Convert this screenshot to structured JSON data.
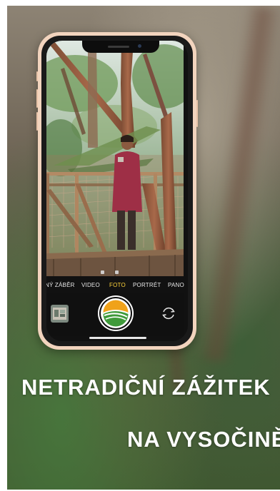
{
  "camera": {
    "modes": [
      {
        "label": "NÝ ZÁBĚR",
        "active": false
      },
      {
        "label": "VIDEO",
        "active": false
      },
      {
        "label": "FOTO",
        "active": true
      },
      {
        "label": "PORTRÉT",
        "active": false
      },
      {
        "label": "PANO",
        "active": false
      }
    ],
    "icons": {
      "shutter": "brand-logo-icon",
      "flip": "camera-flip-icon",
      "thumbnail": "last-photo-thumbnail"
    }
  },
  "headline": {
    "line1": "NETRADIČNÍ ZÁŽITEK",
    "line2": "NA VYSOČINĚ"
  },
  "colors": {
    "phone_frame": "#f2d4be",
    "logo_green": "#3f9a3a",
    "logo_orange": "#f0a21a",
    "text": "#ffffff"
  }
}
